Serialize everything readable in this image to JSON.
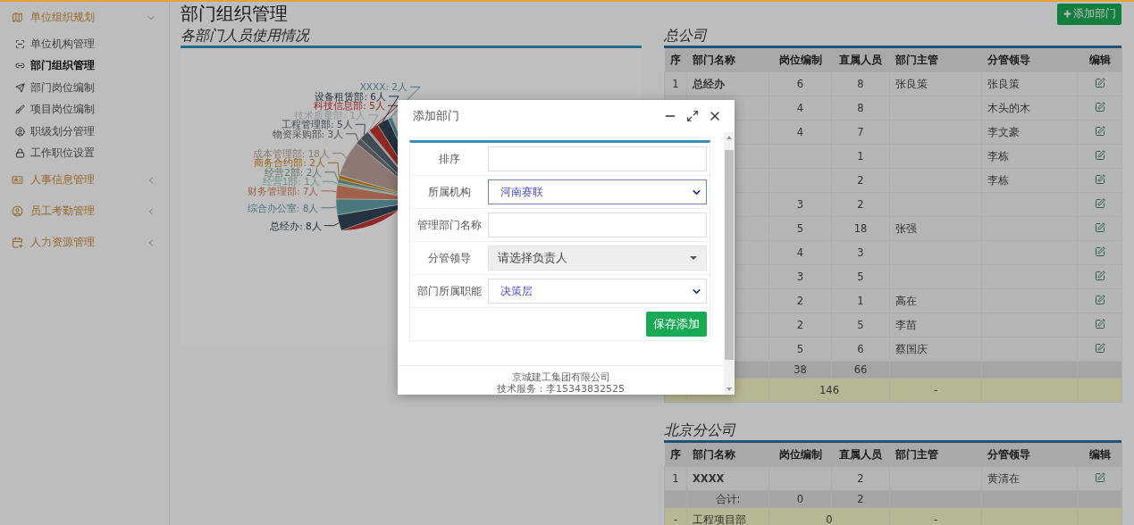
{
  "sidebar": {
    "groups": [
      {
        "label": "单位组织规划",
        "expanded": true,
        "items": [
          {
            "label": "单位机构管理",
            "selected": false
          },
          {
            "label": "部门组织管理",
            "selected": true
          },
          {
            "label": "部门岗位编制",
            "selected": false
          },
          {
            "label": "项目岗位编制",
            "selected": false
          },
          {
            "label": "职级划分管理",
            "selected": false
          },
          {
            "label": "工作职位设置",
            "selected": false
          }
        ]
      },
      {
        "label": "人事信息管理",
        "expanded": false
      },
      {
        "label": "员工考勤管理",
        "expanded": false
      },
      {
        "label": "人力资源管理",
        "expanded": false
      }
    ]
  },
  "page_title": "部门组织管理",
  "add_button": "添加部门",
  "chart_panel": {
    "title": "各部门人员使用情况",
    "slice_labels": [
      "XXXX: 2人",
      "设备租赁部: 6人",
      "科技信息部: 5人",
      "技术质量部: 1人",
      "工程管理部: 5人",
      "物资采购部: 3人",
      "成本管理部: 18人",
      "商务合约部: 2人",
      "经营2部: 2人",
      "经营1部: 1人",
      "财务管理部: 7人",
      "综合办公室: 8人",
      "总经办: 8人"
    ]
  },
  "tables": [
    {
      "title": "总公司",
      "columns": [
        "序",
        "部门名称",
        "岗位编制",
        "直属人员",
        "部门主管",
        "分管领导",
        "编辑"
      ],
      "rows": [
        {
          "kind": "dept",
          "seq": "1",
          "name": "总经办",
          "quota": "6",
          "staff": "8",
          "head": "张良策",
          "leader": "张良策"
        },
        {
          "kind": "dept",
          "quota": "4",
          "staff": "8",
          "leader": "木头的木"
        },
        {
          "kind": "dept",
          "quota": "4",
          "staff": "7",
          "leader": "李文豪"
        },
        {
          "kind": "dept",
          "staff": "1",
          "leader": "李栋"
        },
        {
          "kind": "dept",
          "staff": "2",
          "leader": "李栋"
        },
        {
          "kind": "dept",
          "quota": "3",
          "staff": "2"
        },
        {
          "kind": "dept",
          "quota": "5",
          "staff": "18",
          "head": "张强"
        },
        {
          "kind": "dept",
          "quota": "4",
          "staff": "3"
        },
        {
          "kind": "dept",
          "quota": "3",
          "staff": "5"
        },
        {
          "kind": "dept",
          "quota": "2",
          "staff": "1",
          "head": "高在"
        },
        {
          "kind": "dept",
          "quota": "2",
          "staff": "5",
          "head": "李苗"
        },
        {
          "kind": "dept",
          "quota": "5",
          "staff": "6",
          "head": "蔡国庆"
        },
        {
          "kind": "total",
          "quota": "38",
          "staff": "66"
        },
        {
          "kind": "project",
          "count": "146",
          "head": "-"
        }
      ]
    },
    {
      "title": "北京分公司",
      "columns": [
        "序",
        "部门名称",
        "岗位编制",
        "直属人员",
        "部门主管",
        "分管领导",
        "编辑"
      ],
      "rows": [
        {
          "kind": "dept",
          "seq": "1",
          "name": "XXXX",
          "staff": "2",
          "leader": "黄清在"
        },
        {
          "kind": "total",
          "name": "合计:",
          "quota": "0",
          "staff": "2"
        },
        {
          "kind": "project",
          "seq": "-",
          "name": "工程项目部",
          "count": "0",
          "head": "-"
        }
      ]
    }
  ],
  "dialog": {
    "title": "添加部门",
    "fields": [
      {
        "kind": "input",
        "label": "排序"
      },
      {
        "kind": "select",
        "label": "所属机构",
        "value": "河南赛联",
        "focused": true
      },
      {
        "kind": "input",
        "label": "管理部门名称"
      },
      {
        "kind": "picker",
        "label": "分管领导",
        "value": "请选择负责人"
      },
      {
        "kind": "select",
        "label": "部门所属职能",
        "value": "决策层",
        "focused": false
      }
    ],
    "submit": "保存添加",
    "footer": [
      "京城建工集团有限公司",
      "技术服务：李15343832525"
    ]
  }
}
